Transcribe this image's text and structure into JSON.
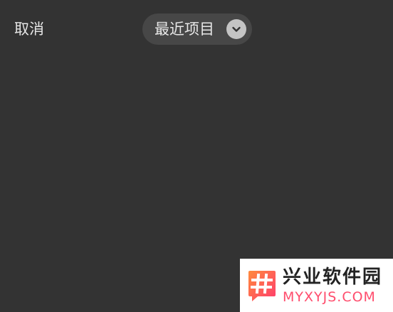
{
  "header": {
    "cancel_label": "取消",
    "album_picker": {
      "label": "最近项目",
      "icon": "chevron-down-icon"
    }
  },
  "watermark": {
    "logo_icon": "hash-logo-icon",
    "title": "兴业软件园",
    "subtitle": "MYXYJS.COM"
  },
  "colors": {
    "background": "#333333",
    "pill": "#474747",
    "text": "#e6e6e6",
    "watermark_accent": "#ff4d6d"
  }
}
